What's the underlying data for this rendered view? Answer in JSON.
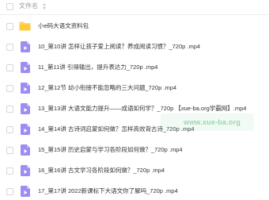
{
  "header": {
    "column_label": "文件名"
  },
  "colors": {
    "folder": "#ffd45f",
    "video_icon": "#9c8df3",
    "text": "#333333",
    "header_text": "#9a9a9a"
  },
  "rows": [
    {
      "type": "folder",
      "icon": "folder-icon",
      "label": "小e码大语文资料包"
    },
    {
      "type": "video",
      "icon": "video-file-icon",
      "label": "10_第10讲 怎样让孩子爱上阅读？养成阅读习惯？_720p .mp4"
    },
    {
      "type": "video",
      "icon": "video-file-icon",
      "label": "11_第11讲 引得输出，提升表达力_720p .mp4"
    },
    {
      "type": "video",
      "icon": "video-file-icon",
      "label": "12_第12节 幼小衔接不能忽略的三大问题_720p .mp4"
    },
    {
      "type": "video",
      "icon": "video-file-icon",
      "label": "13_第13讲 大语文能力提升——成语如何学？_720p 【xue-ba.org学霸网】.mp4"
    },
    {
      "type": "video",
      "icon": "video-file-icon",
      "label": "14_第14讲 古诗词启蒙如何做？怎样高效背古诗_720p .mp4"
    },
    {
      "type": "video",
      "icon": "video-file-icon",
      "label": "15_第15讲 历史启蒙与学习各阶段如何做？_720p .mp4"
    },
    {
      "type": "video",
      "icon": "video-file-icon",
      "label": "16_第16讲 古文学习各阶段如何做？_720p .mp4"
    },
    {
      "type": "video",
      "icon": "video-file-icon",
      "label": "17_第17讲 2022新课标下大语文你了解吗_720p .mp4"
    }
  ],
  "watermark": {
    "text": "www.xue-ba.org"
  }
}
